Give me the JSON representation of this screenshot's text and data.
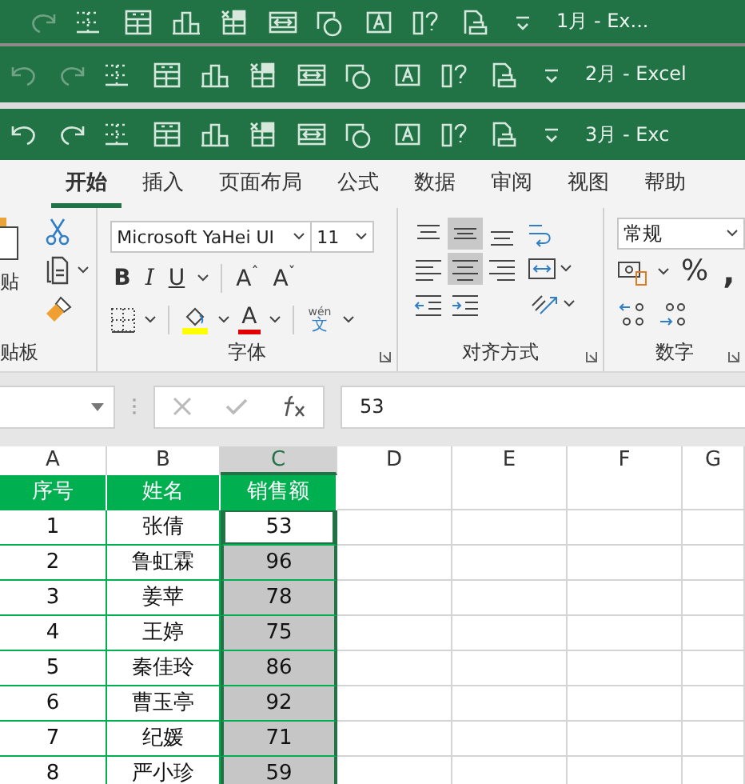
{
  "windows": [
    {
      "title": "1月 - Ex..."
    },
    {
      "title": "2月 - Excel"
    },
    {
      "title": "3月 - Exc"
    }
  ],
  "ribbon_tabs": [
    {
      "label": "开始",
      "selected": true
    },
    {
      "label": "插入",
      "selected": false
    },
    {
      "label": "页面布局",
      "selected": false
    },
    {
      "label": "公式",
      "selected": false
    },
    {
      "label": "数据",
      "selected": false
    },
    {
      "label": "审阅",
      "selected": false
    },
    {
      "label": "视图",
      "selected": false
    },
    {
      "label": "帮助",
      "selected": false
    }
  ],
  "clipboard": {
    "paste_label": "贴",
    "group_label": "贴板"
  },
  "font": {
    "name": "Microsoft YaHei UI",
    "size": "11",
    "bold": "B",
    "italic": "I",
    "underline": "U",
    "grow": "A",
    "grow_mark": "ˆ",
    "shrink": "A",
    "shrink_mark": "ˇ",
    "font_color": "A",
    "phonetic_top": "wén",
    "phonetic": "文",
    "group_label": "字体"
  },
  "alignment": {
    "middle_align_on": true,
    "center_on": true,
    "group_label": "对齐方式"
  },
  "number": {
    "format": "常规",
    "percent": "%",
    "comma": ",",
    "group_label": "数字"
  },
  "formula_bar": {
    "value": "53"
  },
  "columns": [
    {
      "label": "A",
      "selected": false
    },
    {
      "label": "B",
      "selected": false
    },
    {
      "label": "C",
      "selected": true
    },
    {
      "label": "D",
      "selected": false
    },
    {
      "label": "E",
      "selected": false
    },
    {
      "label": "F",
      "selected": false
    },
    {
      "label": "G",
      "selected": false
    }
  ],
  "table": {
    "header": [
      "序号",
      "姓名",
      "销售额"
    ],
    "rows": [
      {
        "no": "1",
        "name": "张倩",
        "sales": "53",
        "active": true
      },
      {
        "no": "2",
        "name": "鲁虹霖",
        "sales": "96",
        "active": false
      },
      {
        "no": "3",
        "name": "姜苹",
        "sales": "78",
        "active": false
      },
      {
        "no": "4",
        "name": "王婷",
        "sales": "75",
        "active": false
      },
      {
        "no": "5",
        "name": "秦佳玲",
        "sales": "86",
        "active": false
      },
      {
        "no": "6",
        "name": "曹玉亭",
        "sales": "92",
        "active": false
      },
      {
        "no": "7",
        "name": "纪媛",
        "sales": "71",
        "active": false
      },
      {
        "no": "8",
        "name": "严小珍",
        "sales": "59",
        "active": false
      }
    ]
  }
}
